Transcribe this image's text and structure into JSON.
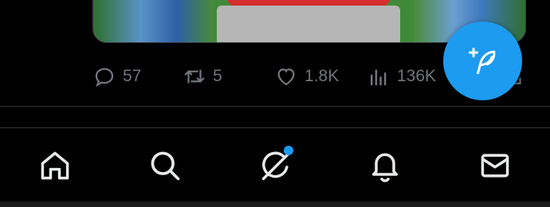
{
  "tweet": {
    "metrics": {
      "replies": "57",
      "retweets": "5",
      "likes": "1.8K",
      "views": "136K"
    }
  },
  "compose": {
    "icon": "feather-plus-icon"
  },
  "nav": {
    "items": [
      {
        "name": "home",
        "icon": "home-icon"
      },
      {
        "name": "search",
        "icon": "search-icon"
      },
      {
        "name": "grok",
        "icon": "grok-icon",
        "has_notification_dot": true
      },
      {
        "name": "notifications",
        "icon": "bell-icon"
      },
      {
        "name": "messages",
        "icon": "mail-icon"
      }
    ]
  },
  "colors": {
    "background": "#000000",
    "muted_text": "#71767b",
    "accent": "#1d9bf0",
    "divider": "#2f3336",
    "icon_white": "#e7e9ea"
  }
}
